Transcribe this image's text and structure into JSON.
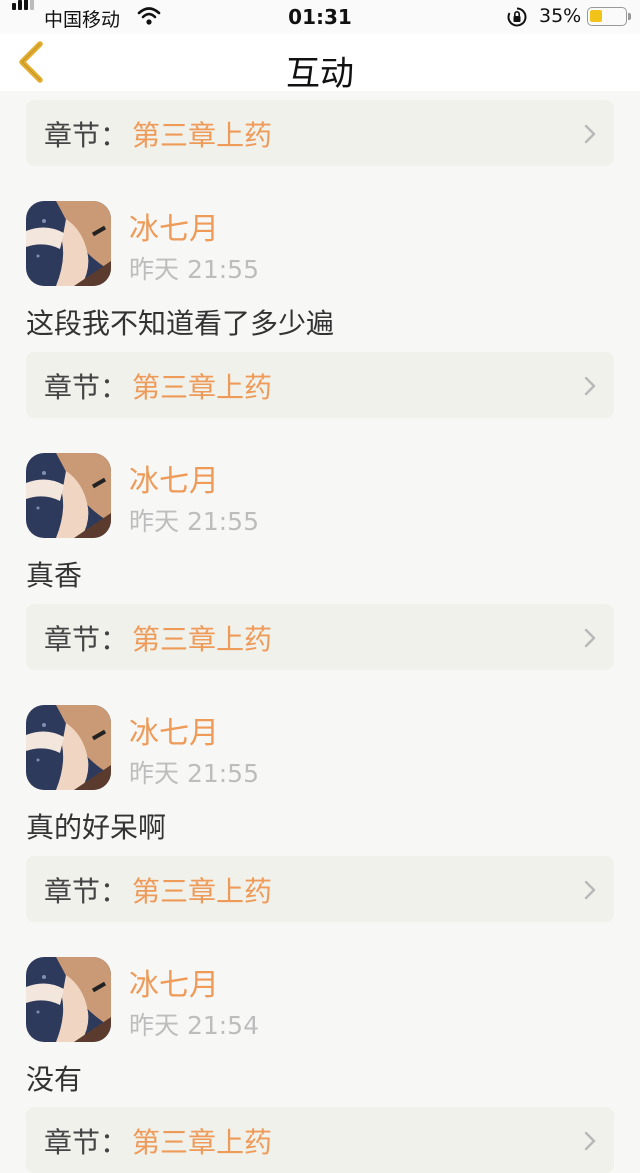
{
  "status_bar": {
    "carrier": "中国移动",
    "time": "01:31",
    "battery": "35%",
    "battery_level": 0.35
  },
  "nav": {
    "title": "互动",
    "back_icon": "chevron-left-icon"
  },
  "chapter_label": "章节：",
  "first_chapter": {
    "name": "第三章上药"
  },
  "comments": [
    {
      "user": "冰七月",
      "time": "昨天 21:55",
      "text": "这段我不知道看了多少遍",
      "chapter": "第三章上药"
    },
    {
      "user": "冰七月",
      "time": "昨天 21:55",
      "text": "真香",
      "chapter": "第三章上药"
    },
    {
      "user": "冰七月",
      "time": "昨天 21:55",
      "text": "真的好呆啊",
      "chapter": "第三章上药"
    },
    {
      "user": "冰七月",
      "time": "昨天 21:54",
      "text": "没有",
      "chapter": "第三章上药"
    }
  ],
  "colors": {
    "accent": "#ee9a58",
    "chapter_bg": "#f1f1eb",
    "back_icon": "#e5ad2c"
  }
}
